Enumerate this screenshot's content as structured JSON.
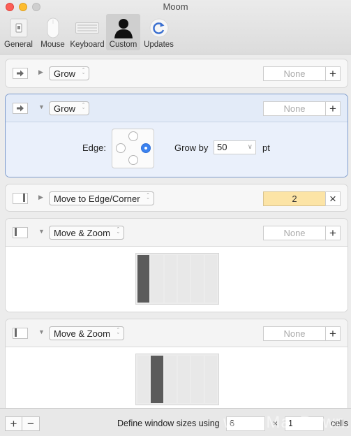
{
  "window": {
    "title": "Moom"
  },
  "toolbar": {
    "items": [
      {
        "label": "General",
        "icon": "general-switch-icon"
      },
      {
        "label": "Mouse",
        "icon": "mouse-icon"
      },
      {
        "label": "Keyboard",
        "icon": "keyboard-icon"
      },
      {
        "label": "Custom",
        "icon": "person-silhouette-icon",
        "selected": true
      },
      {
        "label": "Updates",
        "icon": "refresh-arrow-icon"
      }
    ]
  },
  "actions": [
    {
      "kind_icon": "arrow-right-icon",
      "expanded": false,
      "action_type": "Grow",
      "shortcut": "None",
      "shortcut_button": "+"
    },
    {
      "kind_icon": "arrow-right-icon",
      "expanded": true,
      "selected": true,
      "action_type": "Grow",
      "shortcut": "None",
      "shortcut_button": "+",
      "edge_label": "Edge:",
      "edge_selected": "right",
      "grow_by_label": "Grow by",
      "grow_by_value": "50",
      "grow_by_unit": "pt"
    },
    {
      "kind_icon": "window-edge-icon",
      "expanded": false,
      "action_type": "Move to Edge/Corner",
      "shortcut": "2",
      "shortcut_button": "×"
    },
    {
      "kind_icon": "window-left-column-icon",
      "expanded": true,
      "action_type": "Move & Zoom",
      "shortcut": "None",
      "shortcut_button": "+",
      "grid_columns": 6,
      "filled_columns": [
        1
      ]
    },
    {
      "kind_icon": "window-left-column-icon",
      "expanded": true,
      "action_type": "Move & Zoom",
      "shortcut": "None",
      "shortcut_button": "+",
      "grid_columns": 6,
      "filled_columns": [
        2
      ]
    }
  ],
  "bottom": {
    "add_label": "+",
    "remove_label": "−",
    "define_text": "Define window sizes using",
    "columns_value": "6",
    "times": "×",
    "rows_value": "1",
    "cells_text": "cells",
    "watermark": "www.MacDown.com"
  },
  "colors": {
    "selected_border": "#7f9ccc",
    "selected_bg": "#e6eefb",
    "shortcut_set_bg": "#fce4a6",
    "radio_on": "#3b82f0",
    "grid_filled": "#5b5b5b"
  }
}
